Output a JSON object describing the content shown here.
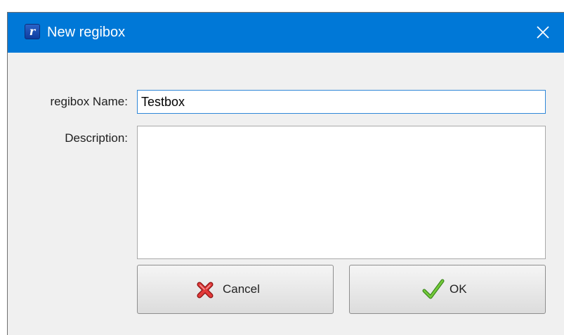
{
  "window": {
    "title": "New regibox",
    "title_bar_color": "#0078d7"
  },
  "form": {
    "name_label": "regibox Name:",
    "name_value": "Testbox",
    "description_label": "Description:",
    "description_value": ""
  },
  "buttons": {
    "cancel_label": "Cancel",
    "ok_label": "OK"
  },
  "icons": {
    "app": "regibox-app-icon",
    "close": "close-icon",
    "cancel": "red-x-icon",
    "ok": "green-check-icon"
  }
}
